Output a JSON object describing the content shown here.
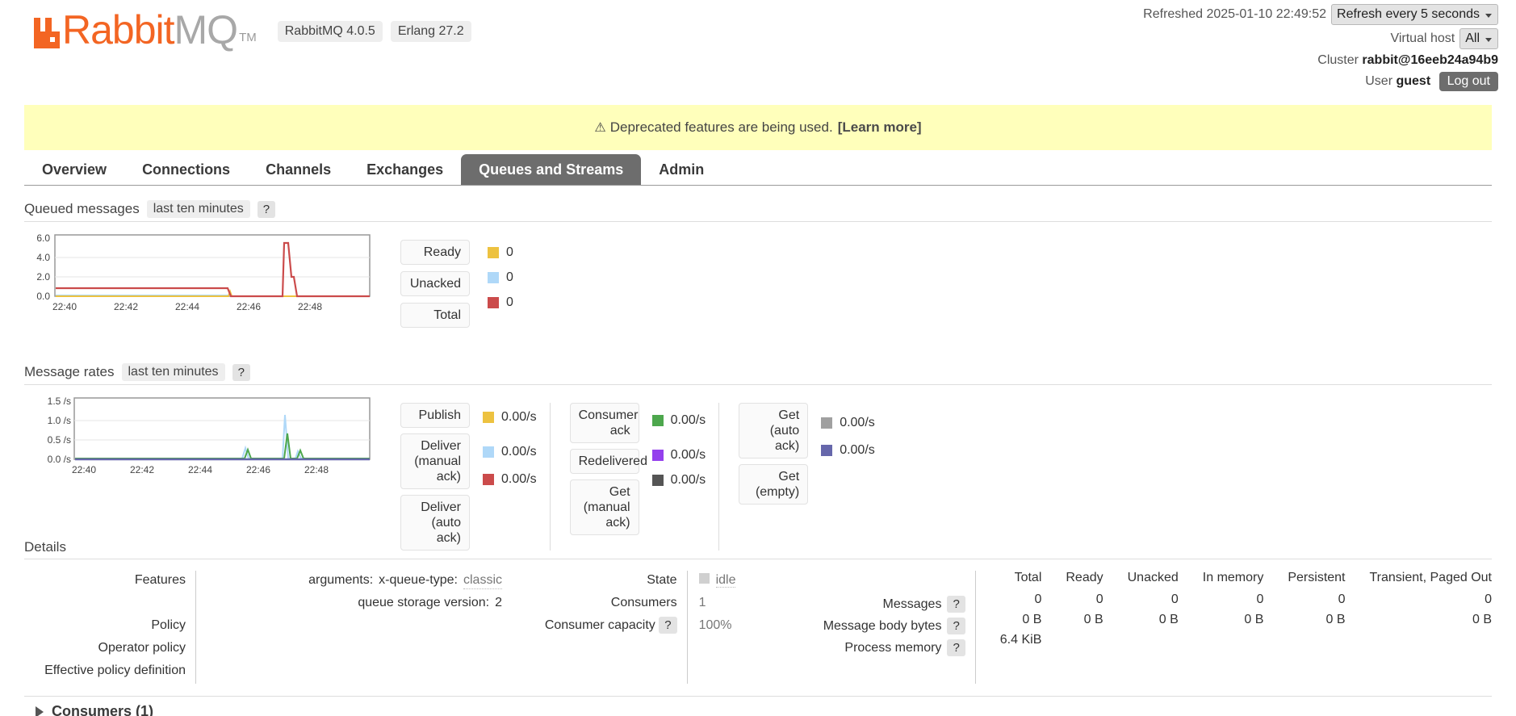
{
  "header": {
    "logo": {
      "part1": "Rabbit",
      "part2": "MQ",
      "tm": "TM"
    },
    "badges": [
      "RabbitMQ 4.0.5",
      "Erlang 27.2"
    ],
    "refreshed_label": "Refreshed 2025-01-10 22:49:52",
    "refresh_select": "Refresh every 5 seconds",
    "vhost_label": "Virtual host",
    "vhost_select": "All",
    "cluster_label": "Cluster",
    "cluster_value": "rabbit@16eeb24a94b9",
    "user_label": "User",
    "user_value": "guest",
    "logout_label": "Log out"
  },
  "warning": {
    "icon": "warning-triangle-icon",
    "text": "Deprecated features are being used.",
    "link": "[Learn more]"
  },
  "tabs": [
    {
      "label": "Overview",
      "active": false
    },
    {
      "label": "Connections",
      "active": false
    },
    {
      "label": "Channels",
      "active": false
    },
    {
      "label": "Exchanges",
      "active": false
    },
    {
      "label": "Queues and Streams",
      "active": true
    },
    {
      "label": "Admin",
      "active": false
    }
  ],
  "queued_messages": {
    "title": "Queued messages",
    "range": "last ten minutes",
    "help": "?",
    "legend": [
      {
        "label": "Ready",
        "color": "#edc240",
        "value": "0"
      },
      {
        "label": "Unacked",
        "color": "#afd8f8",
        "value": "0"
      },
      {
        "label": "Total",
        "color": "#cb4b4b",
        "value": "0"
      }
    ]
  },
  "message_rates": {
    "title": "Message rates",
    "range": "last ten minutes",
    "help": "?",
    "columns": [
      [
        {
          "label": "Publish",
          "color": "#edc240",
          "value": "0.00/s"
        },
        {
          "label": "Deliver (manual ack)",
          "color": "#afd8f8",
          "value": "0.00/s"
        },
        {
          "label": "Deliver (auto ack)",
          "color": "#cb4b4b",
          "value": "0.00/s"
        }
      ],
      [
        {
          "label": "Consumer ack",
          "color": "#4da74d",
          "value": "0.00/s"
        },
        {
          "label": "Redelivered",
          "color": "#9440ed",
          "value": "0.00/s"
        },
        {
          "label": "Get (manual ack)",
          "color": "#555555",
          "value": "0.00/s"
        }
      ],
      [
        {
          "label": "Get (auto ack)",
          "color": "#a0a0a0",
          "value": "0.00/s"
        },
        {
          "label": "Get (empty)",
          "color": "#6667ab",
          "value": "0.00/s"
        }
      ]
    ]
  },
  "chart_data": [
    {
      "type": "line",
      "title": "Queued messages",
      "subtitle": "last ten minutes",
      "xlabel": "",
      "ylabel": "",
      "ylim": [
        0,
        6
      ],
      "yticks": [
        "0.0",
        "2.0",
        "4.0",
        "6.0"
      ],
      "xticks": [
        "22:40",
        "22:42",
        "22:44",
        "22:46",
        "22:48"
      ],
      "grid": true,
      "legend_position": "right",
      "series": [
        {
          "name": "Ready",
          "color": "#edc240",
          "current": 0,
          "x": [
            0,
            55,
            58,
            60,
            74,
            76,
            80,
            84,
            88,
            100
          ],
          "values": [
            0,
            0,
            0,
            0,
            0,
            0,
            0,
            0,
            0,
            0
          ]
        },
        {
          "name": "Unacked",
          "color": "#afd8f8",
          "current": 0,
          "x": [
            0,
            55,
            58,
            60,
            74,
            76,
            80,
            84,
            88,
            100
          ],
          "values": [
            0.06,
            0.06,
            0.06,
            0,
            0,
            0,
            0,
            0,
            0,
            0
          ]
        },
        {
          "name": "Total",
          "color": "#cb4b4b",
          "current": 0,
          "x": [
            0,
            54,
            57,
            59,
            73,
            74.5,
            76,
            78.5,
            79.5,
            82,
            84,
            100
          ],
          "values": [
            1,
            1,
            1,
            0,
            0,
            5,
            5,
            2,
            2,
            0,
            0,
            0
          ]
        }
      ]
    },
    {
      "type": "line",
      "title": "Message rates",
      "subtitle": "last ten minutes",
      "xlabel": "",
      "ylabel": "/s",
      "ylim": [
        0,
        1.5
      ],
      "yticks": [
        "0.0 /s",
        "0.5 /s",
        "1.0 /s",
        "1.5 /s"
      ],
      "xticks": [
        "22:40",
        "22:42",
        "22:44",
        "22:46",
        "22:48"
      ],
      "grid": true,
      "legend_position": "right",
      "series": [
        {
          "name": "Publish",
          "color": "#edc240",
          "current": "0.00/s",
          "x": [
            0,
            100
          ],
          "values": [
            0,
            0
          ]
        },
        {
          "name": "Deliver (manual ack)",
          "color": "#afd8f8",
          "current": "0.00/s",
          "x": [
            0,
            55,
            57,
            59,
            61,
            73,
            75,
            77,
            79,
            81,
            83,
            100
          ],
          "values": [
            0,
            0,
            0.26,
            0,
            0,
            0,
            1.03,
            0,
            0,
            0.2,
            0,
            0
          ]
        },
        {
          "name": "Deliver (auto ack)",
          "color": "#cb4b4b",
          "current": "0.00/s",
          "x": [
            0,
            100
          ],
          "values": [
            0,
            0
          ]
        },
        {
          "name": "Consumer ack",
          "color": "#4da74d",
          "current": "0.00/s",
          "x": [
            0,
            56,
            58,
            60,
            62,
            74,
            76,
            78,
            80,
            82,
            84,
            100
          ],
          "values": [
            0,
            0,
            0.22,
            0,
            0,
            0,
            0.62,
            0,
            0,
            0.22,
            0,
            0
          ]
        },
        {
          "name": "Redelivered",
          "color": "#9440ed",
          "current": "0.00/s",
          "x": [
            0,
            100
          ],
          "values": [
            0,
            0
          ]
        },
        {
          "name": "Get (manual ack)",
          "color": "#555555",
          "current": "0.00/s",
          "x": [
            0,
            100
          ],
          "values": [
            0,
            0
          ]
        },
        {
          "name": "Get (auto ack)",
          "color": "#a0a0a0",
          "current": "0.00/s",
          "x": [
            0,
            100
          ],
          "values": [
            0,
            0
          ]
        },
        {
          "name": "Get (empty)",
          "color": "#6667ab",
          "current": "0.00/s",
          "x": [
            0,
            100
          ],
          "values": [
            0,
            0
          ]
        }
      ]
    }
  ],
  "details": {
    "title": "Details",
    "left_labels": [
      "Features",
      "Policy",
      "Operator policy",
      "Effective policy definition"
    ],
    "features": [
      {
        "key": "arguments:",
        "subkey": "x-queue-type:",
        "value": "classic"
      },
      {
        "key": "queue storage version:",
        "subkey": "",
        "value": "2"
      }
    ],
    "middle": [
      {
        "label": "State",
        "help": "",
        "value": "idle",
        "swatch": true
      },
      {
        "label": "Consumers",
        "help": "",
        "value": "1",
        "swatch": false
      },
      {
        "label": "Consumer capacity",
        "help": "?",
        "value": "100%",
        "swatch": false
      }
    ],
    "stats": {
      "columns": [
        "Total",
        "Ready",
        "Unacked",
        "In memory",
        "Persistent",
        "Transient, Paged Out"
      ],
      "rows": [
        {
          "label": "Messages",
          "help": "?",
          "values": [
            "0",
            "0",
            "0",
            "0",
            "0",
            "0"
          ]
        },
        {
          "label": "Message body bytes",
          "help": "?",
          "values": [
            "0 B",
            "0 B",
            "0 B",
            "0 B",
            "0 B",
            "0 B"
          ]
        },
        {
          "label": "Process memory",
          "help": "?",
          "values": [
            "6.4 KiB",
            "",
            "",
            "",
            "",
            ""
          ]
        }
      ]
    }
  },
  "consumers_section": {
    "label": "Consumers (1)",
    "expander": "triangle-right-icon"
  }
}
